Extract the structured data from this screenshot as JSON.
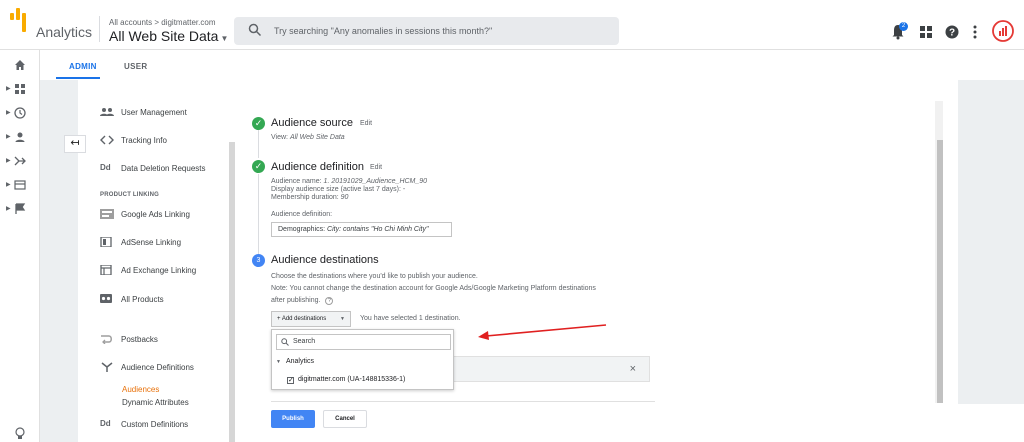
{
  "header": {
    "app_name": "Analytics",
    "breadcrumb": "All accounts > digitmatter.com",
    "view_name": "All Web Site Data",
    "search_placeholder": "Try searching \"Any anomalies in sessions this month?\"",
    "notification_count": "2"
  },
  "tabs": [
    {
      "label": "ADMIN",
      "active": true
    },
    {
      "label": "USER",
      "active": false
    }
  ],
  "leftnav": [
    "home-icon",
    "dashboard-icon",
    "clock-icon",
    "person-icon",
    "acquisition-icon",
    "table-icon",
    "flag-icon"
  ],
  "subnav": {
    "items": [
      {
        "label": "User Management",
        "icon": "people-icon"
      },
      {
        "label": "Tracking Info",
        "icon": "code-icon"
      },
      {
        "label": "Data Deletion Requests",
        "icon": "dd-icon"
      }
    ],
    "product_linking_header": "PRODUCT LINKING",
    "linking": [
      {
        "label": "Google Ads Linking",
        "icon": "ads-icon"
      },
      {
        "label": "AdSense Linking",
        "icon": "adsense-icon"
      },
      {
        "label": "Ad Exchange Linking",
        "icon": "adexchange-icon"
      },
      {
        "label": "All Products",
        "icon": "products-icon"
      }
    ],
    "more": [
      {
        "label": "Postbacks",
        "icon": "postbacks-icon"
      },
      {
        "label": "Audience Definitions",
        "icon": "audience-icon"
      }
    ],
    "audience_children": [
      "Audiences",
      "Dynamic Attributes"
    ],
    "custom_definitions": "Custom Definitions",
    "custom_icon_text": "Dd"
  },
  "steps": {
    "source": {
      "title": "Audience source",
      "edit": "Edit",
      "view_label": "View:",
      "view_value": "All Web Site Data"
    },
    "definition": {
      "title": "Audience definition",
      "edit": "Edit",
      "name_label": "Audience name:",
      "name_value": "1. 20191029_Audience_HCM_90",
      "size_label": "Display audience size (active last 7 days):",
      "size_value": "-",
      "duration_label": "Membership duration:",
      "duration_value": "90",
      "def_label": "Audience definition:",
      "def_prefix": "Demographics:",
      "def_value": "City: contains \"Ho Chi Minh City\""
    },
    "destinations": {
      "number": "3",
      "title": "Audience destinations",
      "line1": "Choose the destinations where you'd like to publish your audience.",
      "line2": "Note: You cannot change the destination account for Google Ads/Google Marketing Platform destinations",
      "line3": "after publishing.",
      "help": "?",
      "add_button": "+ Add destinations",
      "selected_text": "You have selected 1 destination.",
      "dropdown": {
        "search_placeholder": "Search",
        "group": "Analytics",
        "item": "digitmatter.com (UA-148815336-1)",
        "item_checked": true
      },
      "remove": "×"
    }
  },
  "buttons": {
    "publish": "Publish",
    "cancel": "Cancel"
  },
  "colors": {
    "accent": "#1a73e8",
    "success": "#34a853",
    "step": "#4285f4",
    "active_link": "#e8710a",
    "annotation_arrow": "#e02020"
  }
}
